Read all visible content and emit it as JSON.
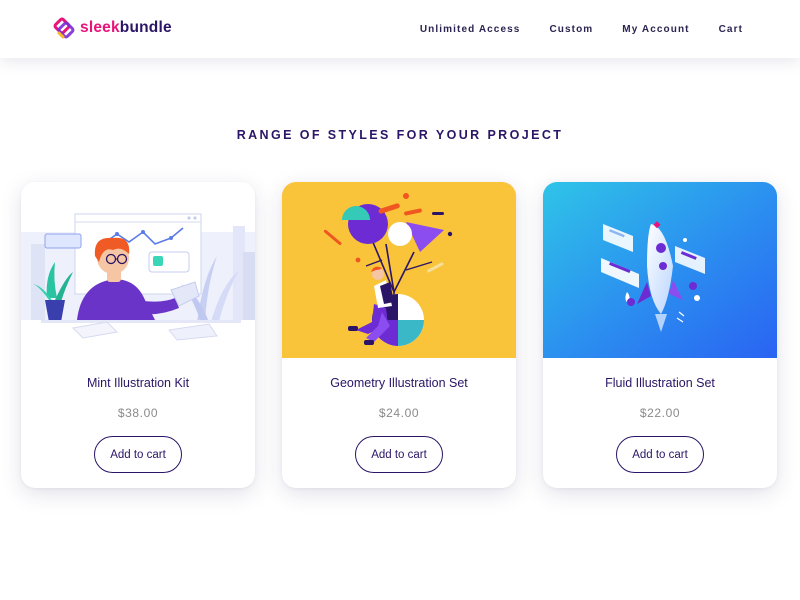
{
  "brand": {
    "name_part1": "sleek",
    "name_part2": "bundle",
    "colors": {
      "primary": "#2a1566",
      "pink": "#e8147a",
      "yellow": "#f9b824",
      "teal": "#2fc4e8"
    }
  },
  "nav": {
    "items": [
      {
        "label": "Unlimited Access"
      },
      {
        "label": "Custom"
      },
      {
        "label": "My Account"
      },
      {
        "label": "Cart"
      }
    ]
  },
  "section": {
    "title": "RANGE OF STYLES FOR YOUR PROJECT"
  },
  "products": [
    {
      "name": "Mint Illustration Kit",
      "price": "$38.00",
      "button": "Add to cart",
      "image": "office-illustration"
    },
    {
      "name": "Geometry Illustration Set",
      "price": "$24.00",
      "button": "Add to cart",
      "image": "geometry-illustration"
    },
    {
      "name": "Fluid Illustration Set",
      "price": "$22.00",
      "button": "Add to cart",
      "image": "rocket-illustration"
    }
  ]
}
